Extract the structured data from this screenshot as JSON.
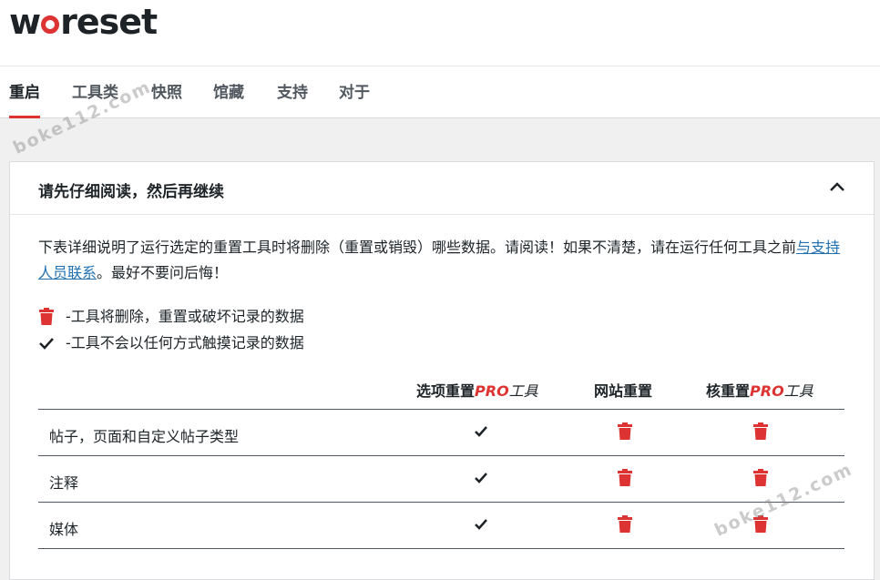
{
  "logo": {
    "prefix": "w",
    "suffix": "reset"
  },
  "tabs": [
    {
      "label": "重启",
      "active": true
    },
    {
      "label": "工具类",
      "active": false
    },
    {
      "label": "快照",
      "active": false
    },
    {
      "label": "馆藏",
      "active": false
    },
    {
      "label": "支持",
      "active": false
    },
    {
      "label": "对于",
      "active": false
    }
  ],
  "card": {
    "title": "请先仔细阅读，然后再继续",
    "intro_before": "下表详细说明了运行选定的重置工具时将删除（重置或销毁）哪些数据。请阅读！如果不清楚，请在运行任何工具之前",
    "intro_link": "与支持人员联系",
    "intro_after": "。最好不要问后悔！",
    "legend": {
      "delete": "-工具将删除，重置或破坏记录的数据",
      "keep": "-工具不会以任何方式触摸记录的数据"
    }
  },
  "table": {
    "headers": {
      "col1_main": "选项重置",
      "col1_pro": "PRO",
      "col1_tool": "工具",
      "col2": "网站重置",
      "col3_main": "核重置",
      "col3_pro": "PRO",
      "col3_tool": "工具"
    },
    "rows": [
      {
        "label": "帖子，页面和自定义帖子类型",
        "c1": "check",
        "c2": "trash",
        "c3": "trash"
      },
      {
        "label": "注释",
        "c1": "check",
        "c2": "trash",
        "c3": "trash"
      },
      {
        "label": "媒体",
        "c1": "check",
        "c2": "trash",
        "c3": "trash"
      }
    ]
  },
  "watermark": "boke112.com",
  "colors": {
    "accent": "#dd3333",
    "link": "#2271b1",
    "text": "#1d2327"
  }
}
